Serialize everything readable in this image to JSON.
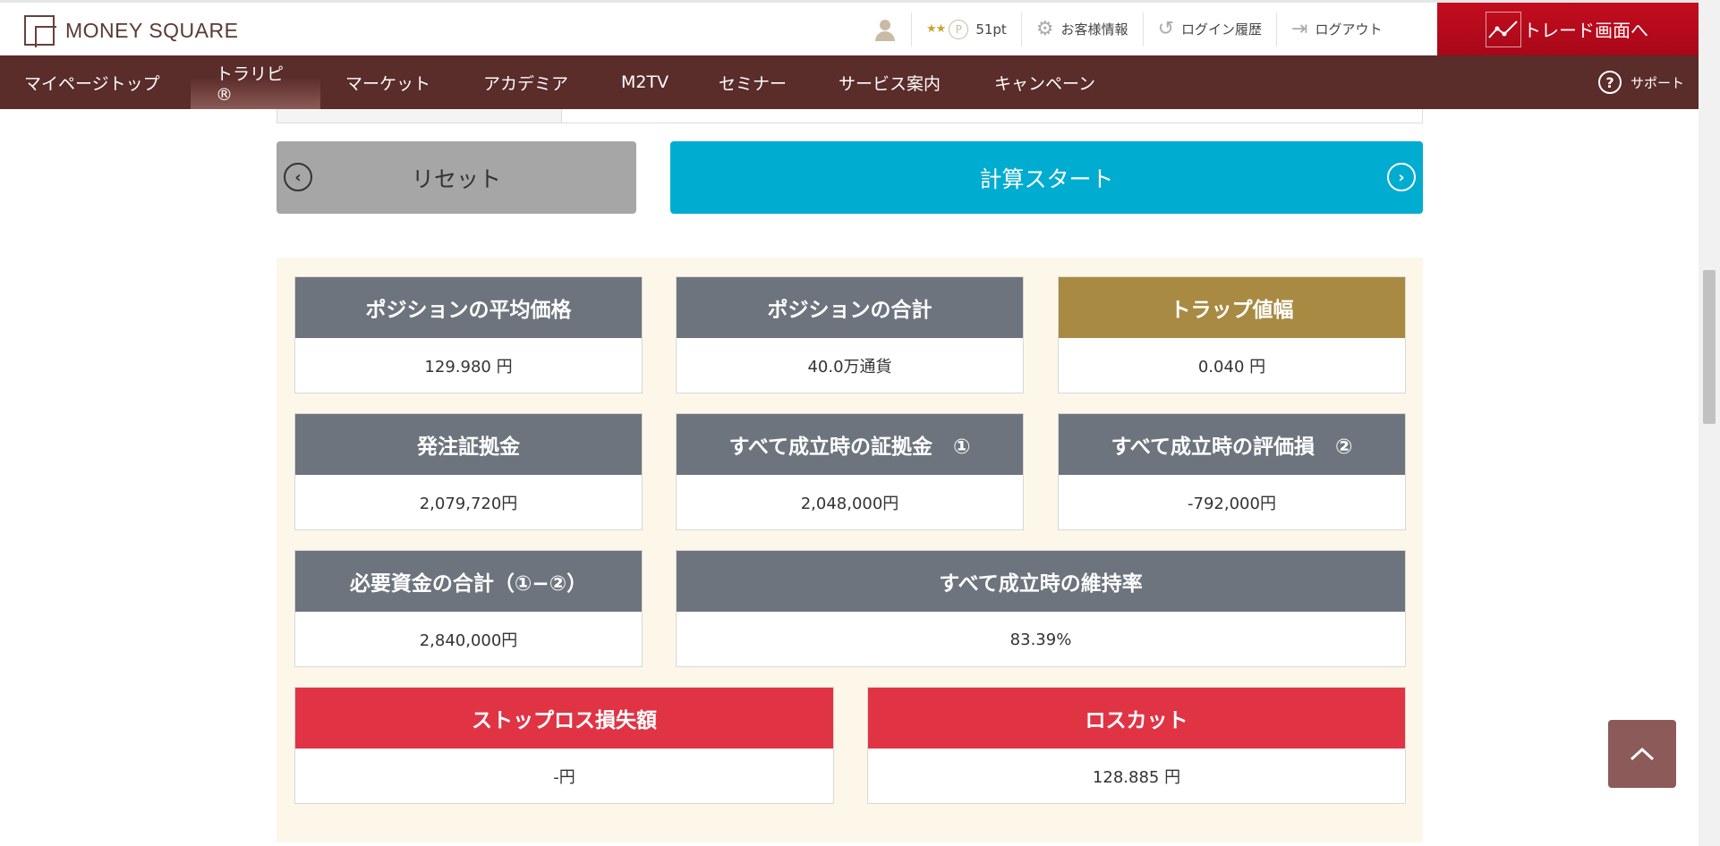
{
  "header": {
    "logo_text": "MONEY SQUARE",
    "stars": "★★",
    "points_icon": "P",
    "points": "51pt",
    "customer_info": "お客様情報",
    "login_history": "ログイン履歴",
    "logout": "ログアウト",
    "trade_button": "トレード画面へ"
  },
  "nav": {
    "items": [
      "マイページトップ",
      "トラリピ®",
      "マーケット",
      "アカデミア",
      "M2TV",
      "セミナー",
      "サービス案内",
      "キャンペーン"
    ],
    "active_index": 1,
    "support": "サポート"
  },
  "buttons": {
    "reset": "リセット",
    "start": "計算スタート"
  },
  "results": {
    "avg_price": {
      "label": "ポジションの平均価格",
      "value": "129.980 円"
    },
    "total_position": {
      "label": "ポジションの合計",
      "value": "40.0万通貨"
    },
    "trap_width": {
      "label": "トラップ値幅",
      "value": "0.040 円"
    },
    "order_margin": {
      "label": "発注証拠金",
      "value": "2,079,720円"
    },
    "all_filled_margin": {
      "label": "すべて成立時の証拠金　①",
      "value": "2,048,000円"
    },
    "all_filled_unrealized": {
      "label": "すべて成立時の評価損　②",
      "value": "-792,000円"
    },
    "required_total": {
      "label": "必要資金の合計（①−②）",
      "value": "2,840,000円"
    },
    "maintenance_rate": {
      "label": "すべて成立時の維持率",
      "value": "83.39%"
    },
    "stoploss_amount": {
      "label": "ストップロス損失額",
      "value": "-円"
    },
    "losscut": {
      "label": "ロスカット",
      "value": "128.885 円"
    }
  },
  "colors": {
    "nav_bg": "#5a2c2a",
    "trade_red": "#c30d1e",
    "start_blue": "#00acd0",
    "card_gray": "#6d747e",
    "card_gold": "#a88a42",
    "card_red": "#e03444",
    "panel_bg": "#fdf7ea"
  }
}
